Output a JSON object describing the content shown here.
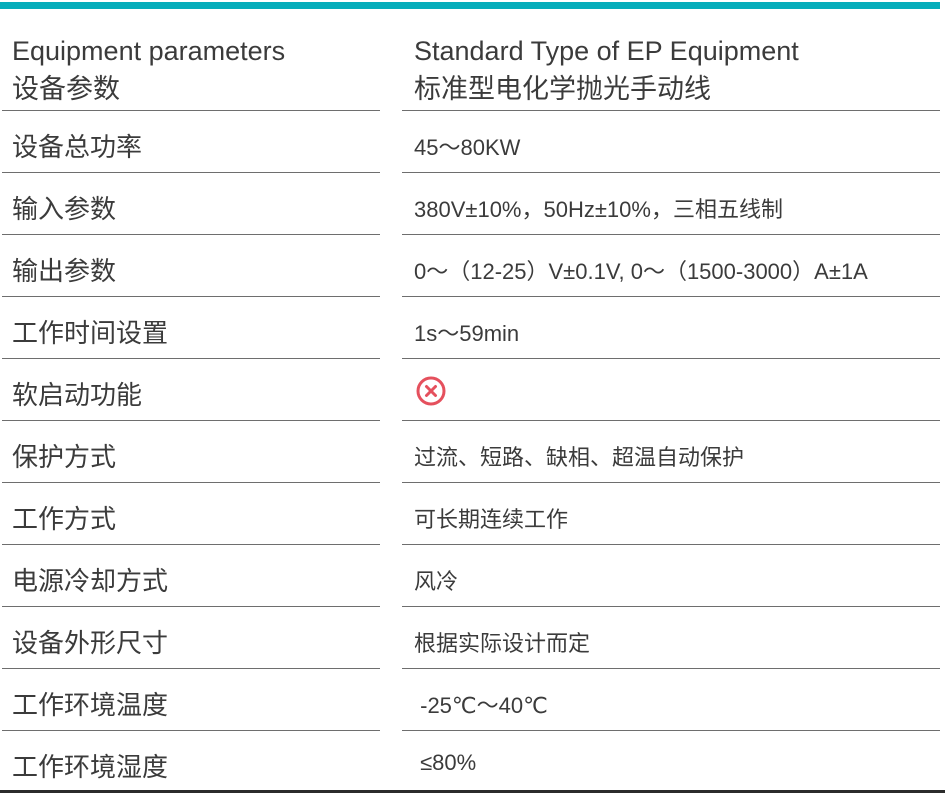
{
  "header": {
    "left_en": "Equipment parameters",
    "left_cn": "设备参数",
    "right_en": "Standard Type of EP Equipment",
    "right_cn": "标准型电化学抛光手动线"
  },
  "colors": {
    "accent_bar": "#06adbb",
    "not_supported_icon": "#e5505d"
  },
  "rows": [
    {
      "label": "设备总功率",
      "value": "45～80KW"
    },
    {
      "label": "输入参数",
      "value": "380V±10%，50Hz±10%，三相五线制"
    },
    {
      "label": "输出参数",
      "value": "0～（12-25）V±0.1V, 0～（1500-3000）A±1A"
    },
    {
      "label": "工作时间设置",
      "value": "1s～59min"
    },
    {
      "label": "软启动功能",
      "value": null,
      "icon": "x-circle-icon"
    },
    {
      "label": "保护方式",
      "value": "过流、短路、缺相、超温自动保护"
    },
    {
      "label": "工作方式",
      "value": "可长期连续工作"
    },
    {
      "label": "电源冷却方式",
      "value": "风冷"
    },
    {
      "label": "设备外形尺寸",
      "value": "根据实际设计而定"
    },
    {
      "label": "工作环境温度",
      "value": " -25℃～40℃"
    },
    {
      "label": "工作环境湿度",
      "value": " ≤80%"
    }
  ]
}
